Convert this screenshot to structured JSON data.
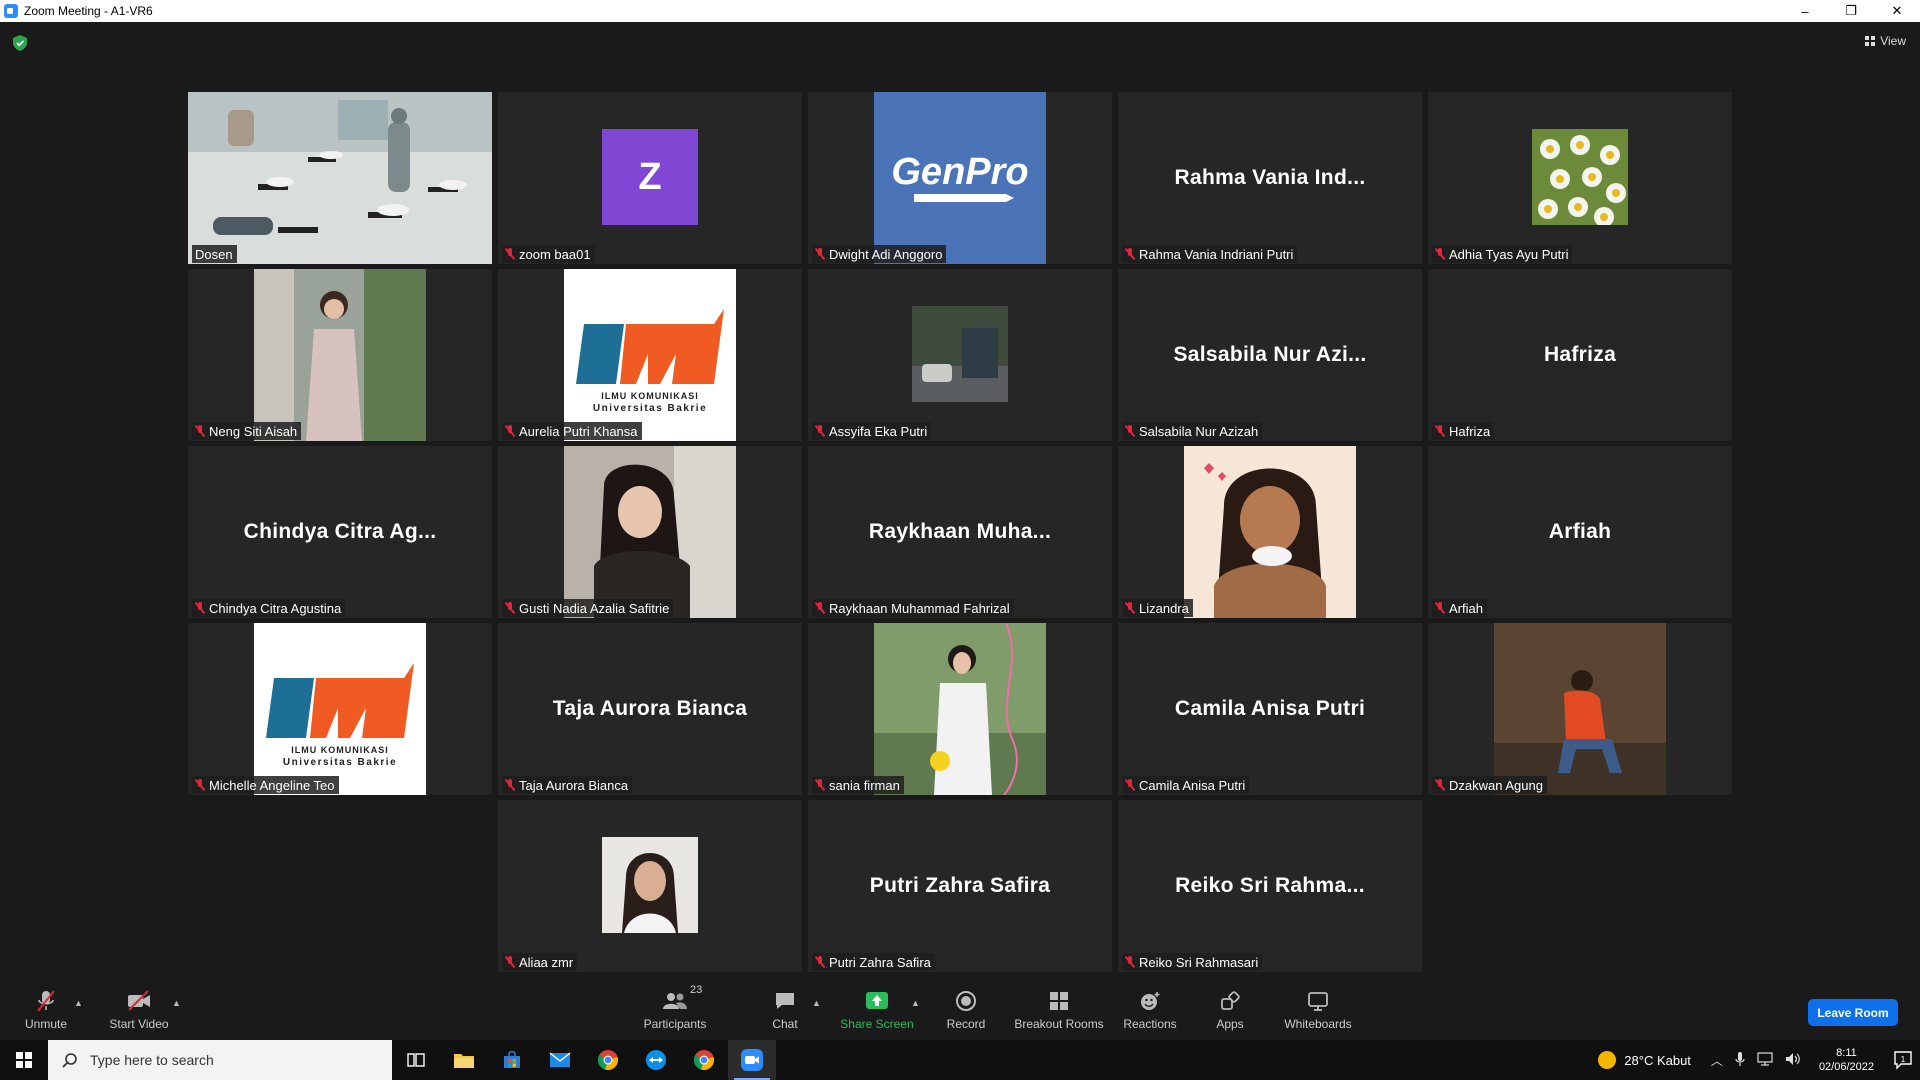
{
  "window": {
    "title": "Zoom Meeting - A1-VR6",
    "minimize": "–",
    "restore": "❐",
    "close": "✕"
  },
  "view_label": "View",
  "colors": {
    "active_speaker": "#c9e66a",
    "leave_button": "#0e71eb",
    "share_green": "#2bbd5d",
    "muted_red": "#e0263a"
  },
  "tiles": [
    {
      "display_name": "Dosen",
      "big_name": "",
      "kind": "video-classroom",
      "active": true,
      "muted": false
    },
    {
      "display_name": "zoom baa01",
      "big_name": "",
      "kind": "avatar-letter",
      "letter": "Z",
      "muted": true
    },
    {
      "display_name": "Dwight Adi Anggoro",
      "big_name": "",
      "kind": "genpro-logo",
      "logo_text": "GenPro",
      "muted": true
    },
    {
      "display_name": "Rahma Vania Indriani Putri",
      "big_name": "Rahma Vania Ind...",
      "kind": "name",
      "muted": true
    },
    {
      "display_name": "Adhia Tyas Ayu Putri",
      "big_name": "",
      "kind": "flower-photo",
      "muted": true
    },
    {
      "display_name": "Neng Siti Aisah",
      "big_name": "",
      "kind": "person-photo",
      "muted": true
    },
    {
      "display_name": "Aurelia Putri Khansa",
      "big_name": "",
      "kind": "ikom-logo",
      "muted": true
    },
    {
      "display_name": "Assyifa Eka Putri",
      "big_name": "",
      "kind": "street-photo",
      "muted": true
    },
    {
      "display_name": "Salsabila Nur Azizah",
      "big_name": "Salsabila Nur Azi...",
      "kind": "name",
      "muted": true
    },
    {
      "display_name": "Hafriza",
      "big_name": "Hafriza",
      "kind": "name",
      "muted": true
    },
    {
      "display_name": "Chindya Citra Agustina",
      "big_name": "Chindya Citra Ag...",
      "kind": "name",
      "muted": true
    },
    {
      "display_name": "Gusti Nadia Azalia Safitrie",
      "big_name": "",
      "kind": "person-photo-2",
      "muted": true
    },
    {
      "display_name": "Raykhaan Muhammad Fahrizal",
      "big_name": "Raykhaan Muha...",
      "kind": "name",
      "muted": true
    },
    {
      "display_name": "Lizandra",
      "big_name": "",
      "kind": "cartoon",
      "muted": true
    },
    {
      "display_name": "Arfiah",
      "big_name": "Arfiah",
      "kind": "name",
      "muted": true
    },
    {
      "display_name": "Michelle Angeline Teo",
      "big_name": "",
      "kind": "ikom-logo",
      "muted": true
    },
    {
      "display_name": "Taja Aurora Bianca",
      "big_name": "Taja Aurora Bianca",
      "kind": "name",
      "muted": true
    },
    {
      "display_name": "sania firman",
      "big_name": "",
      "kind": "person-photo-3",
      "muted": true
    },
    {
      "display_name": "Camila Anisa Putri",
      "big_name": "Camila Anisa Putri",
      "kind": "name",
      "muted": true
    },
    {
      "display_name": "Dzakwan Agung",
      "big_name": "",
      "kind": "person-photo-4",
      "muted": true
    },
    {
      "display_name": "Aliaa zmr",
      "big_name": "",
      "kind": "small-photo",
      "muted": true
    },
    {
      "display_name": "Putri Zahra Safira",
      "big_name": "Putri Zahra Safira",
      "kind": "name",
      "muted": true
    },
    {
      "display_name": "Reiko Sri Rahmasari",
      "big_name": "Reiko Sri Rahma...",
      "kind": "name",
      "muted": true
    }
  ],
  "ikom_logo": {
    "line1": "ILMU KOMUNIKASI",
    "line2": "Universitas Bakrie",
    "mark": "HM"
  },
  "toolbar": {
    "unmute": "Unmute",
    "start_video": "Start Video",
    "participants": "Participants",
    "participants_count": "23",
    "chat": "Chat",
    "share_screen": "Share Screen",
    "record": "Record",
    "breakout_rooms": "Breakout Rooms",
    "reactions": "Reactions",
    "apps": "Apps",
    "whiteboards": "Whiteboards",
    "leave_room": "Leave Room"
  },
  "taskbar": {
    "search_placeholder": "Type here to search",
    "weather": "28°C  Kabut",
    "time": "8:11",
    "date": "02/06/2022",
    "notification_count": "1"
  }
}
